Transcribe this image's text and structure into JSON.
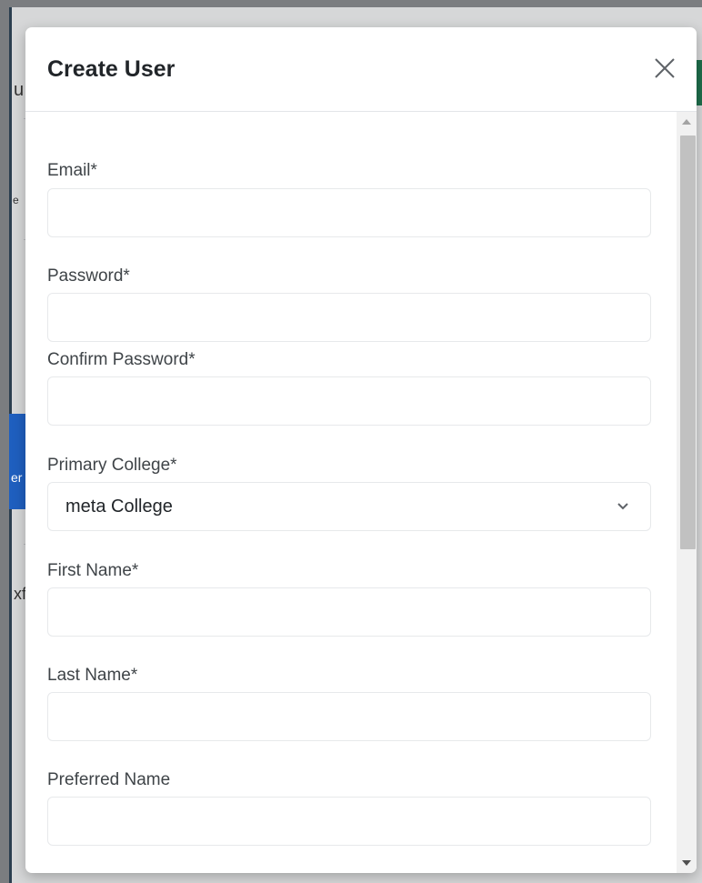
{
  "modal": {
    "title": "Create User",
    "close_icon": "close-icon"
  },
  "form": {
    "email": {
      "label": "Email*",
      "value": ""
    },
    "password": {
      "label": "Password*",
      "value": ""
    },
    "confirm_password": {
      "label": "Confirm Password*",
      "value": ""
    },
    "primary_college": {
      "label": "Primary College*",
      "value": "meta College"
    },
    "first_name": {
      "label": "First Name*",
      "value": ""
    },
    "last_name": {
      "label": "Last Name*",
      "value": ""
    },
    "preferred_name": {
      "label": "Preferred Name",
      "value": ""
    }
  },
  "background": {
    "fragments": [
      "u",
      "e",
      "er",
      "xf"
    ]
  }
}
